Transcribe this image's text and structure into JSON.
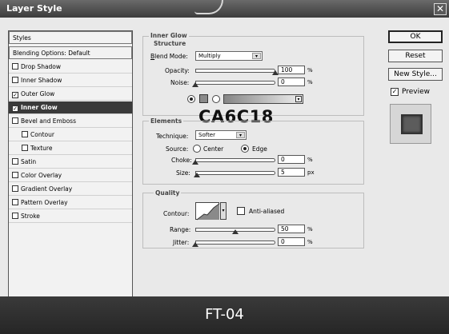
{
  "window": {
    "title": "Layer Style",
    "close_glyph": "✕"
  },
  "styles_list": {
    "header": "Styles",
    "blending": "Blending Options: Default",
    "items": [
      {
        "label": "Drop Shadow",
        "checked": false,
        "indent": false
      },
      {
        "label": "Inner Shadow",
        "checked": false,
        "indent": false
      },
      {
        "label": "Outer Glow",
        "checked": true,
        "indent": false
      },
      {
        "label": "Inner Glow",
        "checked": true,
        "indent": false,
        "selected": true
      },
      {
        "label": "Bevel and Emboss",
        "checked": false,
        "indent": false
      },
      {
        "label": "Contour",
        "checked": false,
        "indent": true
      },
      {
        "label": "Texture",
        "checked": false,
        "indent": true
      },
      {
        "label": "Satin",
        "checked": false,
        "indent": false
      },
      {
        "label": "Color Overlay",
        "checked": false,
        "indent": false
      },
      {
        "label": "Gradient Overlay",
        "checked": false,
        "indent": false
      },
      {
        "label": "Pattern Overlay",
        "checked": false,
        "indent": false
      },
      {
        "label": "Stroke",
        "checked": false,
        "indent": false
      }
    ],
    "check_glyph": "✓"
  },
  "inner_glow": {
    "group_title": "Inner Glow",
    "structure": {
      "title": "Structure",
      "blend_mode_label": "Blend Mode:",
      "blend_mode_value": "Multiply",
      "opacity_label": "Opacity:",
      "opacity_value": "100",
      "opacity_unit": "%",
      "opacity_fraction": 1.0,
      "noise_label": "Noise:",
      "noise_value": "0",
      "noise_unit": "%",
      "noise_fraction": 0.0,
      "color_mode": "solid",
      "swatch_color": "#8a8a8a"
    },
    "elements": {
      "title": "Elements",
      "technique_label": "Technique:",
      "technique_value": "Softer",
      "source_label": "Source:",
      "source_center": "Center",
      "source_edge": "Edge",
      "source_selected": "edge",
      "choke_label": "Choke:",
      "choke_value": "0",
      "choke_unit": "%",
      "choke_fraction": 0.0,
      "size_label": "Size:",
      "size_value": "5",
      "size_unit": "px",
      "size_fraction": 0.02
    },
    "quality": {
      "title": "Quality",
      "contour_label": "Contour:",
      "anti_aliased_label": "Anti-aliased",
      "anti_aliased": false,
      "range_label": "Range:",
      "range_value": "50",
      "range_unit": "%",
      "range_fraction": 0.5,
      "jitter_label": "Jitter:",
      "jitter_value": "0",
      "jitter_unit": "%",
      "jitter_fraction": 0.0
    }
  },
  "overlay_code": "CA6C18",
  "buttons": {
    "ok": "OK",
    "reset": "Reset",
    "new_style": "New Style...",
    "preview_label": "Preview",
    "preview_checked": true
  },
  "caption": "FT-04",
  "dropdown_glyph": "▾"
}
